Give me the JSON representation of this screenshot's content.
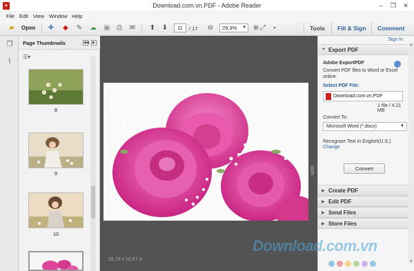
{
  "window": {
    "title": "Download.com.vn.PDF - Adobe Reader",
    "minimize": "–",
    "restore": "❐",
    "close": "✕"
  },
  "menu": [
    "File",
    "Edit",
    "View",
    "Window",
    "Help"
  ],
  "toolbar": {
    "open_label": "Open",
    "page_current": "11",
    "page_total": "/ 17",
    "zoom": "29,3%",
    "tabs": [
      "Tools",
      "Fill & Sign",
      "Comment"
    ]
  },
  "thumbnails": {
    "title": "Page Thumbnails",
    "pages": [
      "8",
      "9",
      "10"
    ]
  },
  "document": {
    "size_label": "15,78 x 10,67 in"
  },
  "right_pane": {
    "signin": "Sign In",
    "export_header": "Export PDF",
    "service_title": "Adobe ExportPDF",
    "service_desc_1": "Convert PDF files to Word or Excel",
    "service_desc_2": "online.",
    "select_file_label": "Select PDF File:",
    "file_name": "Download.com.vn.PDF",
    "file_count": "1 file / 4.21 MB",
    "convert_to_label": "Convert To:",
    "convert_to_value": "Microsoft Word (*.docx)",
    "recognize_text": "Recognize Text in English(U.S.)",
    "change_link": "Change",
    "convert_button": "Convert",
    "panels": [
      "Create PDF",
      "Edit PDF",
      "Send Files",
      "Store Files"
    ]
  },
  "watermark": {
    "text": "Download.com.vn",
    "dot_colors": [
      "#4ca3d9",
      "#e35a5a",
      "#f0b93b",
      "#7cc35b",
      "#b07cd8",
      "#4ca3d9"
    ]
  },
  "colors": {
    "accent": "#2a5f9c",
    "pdf_red": "#c8201c",
    "doc_bg": "#535353"
  }
}
